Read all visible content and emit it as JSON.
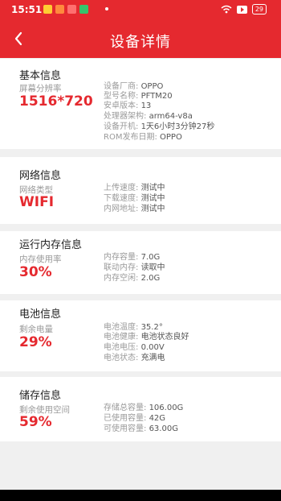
{
  "statusbar": {
    "time": "15:51",
    "battery": "29"
  },
  "header": {
    "title": "设备详情"
  },
  "basic": {
    "title": "基本信息",
    "main_label": "屏幕分辨率",
    "main_value": "1516*720",
    "rows": [
      {
        "k": "设备厂商:",
        "v": "OPPO"
      },
      {
        "k": "型号名称:",
        "v": "PFTM20"
      },
      {
        "k": "安卓版本:",
        "v": "13"
      },
      {
        "k": "处理器架构:",
        "v": "arm64-v8a"
      },
      {
        "k": "设备开机:",
        "v": "1天6小时3分钟27秒"
      },
      {
        "k": "ROM发布日期:",
        "v": "OPPO"
      }
    ]
  },
  "network": {
    "title": "网络信息",
    "main_label": "网络类型",
    "main_value": "WIFI",
    "rows": [
      {
        "k": "上传速度:",
        "v": "测试中"
      },
      {
        "k": "下载速度:",
        "v": "测试中"
      },
      {
        "k": "内网地址:",
        "v": "测试中"
      }
    ]
  },
  "memory": {
    "title": "运行内存信息",
    "main_label": "内存使用率",
    "main_value": "30%",
    "rows": [
      {
        "k": "内存容量:",
        "v": "7.0G"
      },
      {
        "k": "联动内存:",
        "v": "读取中"
      },
      {
        "k": "内存空闲:",
        "v": "2.0G"
      }
    ]
  },
  "battery": {
    "title": "电池信息",
    "main_label": "剩余电量",
    "main_value": "29%",
    "rows": [
      {
        "k": "电池温度:",
        "v": "35.2°"
      },
      {
        "k": "电池健康:",
        "v": "电池状态良好"
      },
      {
        "k": "电池电压:",
        "v": "0.00V"
      },
      {
        "k": "电池状态:",
        "v": "充满电"
      }
    ]
  },
  "storage": {
    "title": "储存信息",
    "main_label": "剩余使用空间",
    "main_value": "59%",
    "rows": [
      {
        "k": "存储总容量:",
        "v": "106.00G"
      },
      {
        "k": "已使用容量:",
        "v": "42G"
      },
      {
        "k": "可使用容量:",
        "v": "63.00G"
      }
    ]
  },
  "icons": {
    "back": "chevron-left-icon",
    "wifi": "wifi-icon",
    "record": "screen-record-icon"
  }
}
